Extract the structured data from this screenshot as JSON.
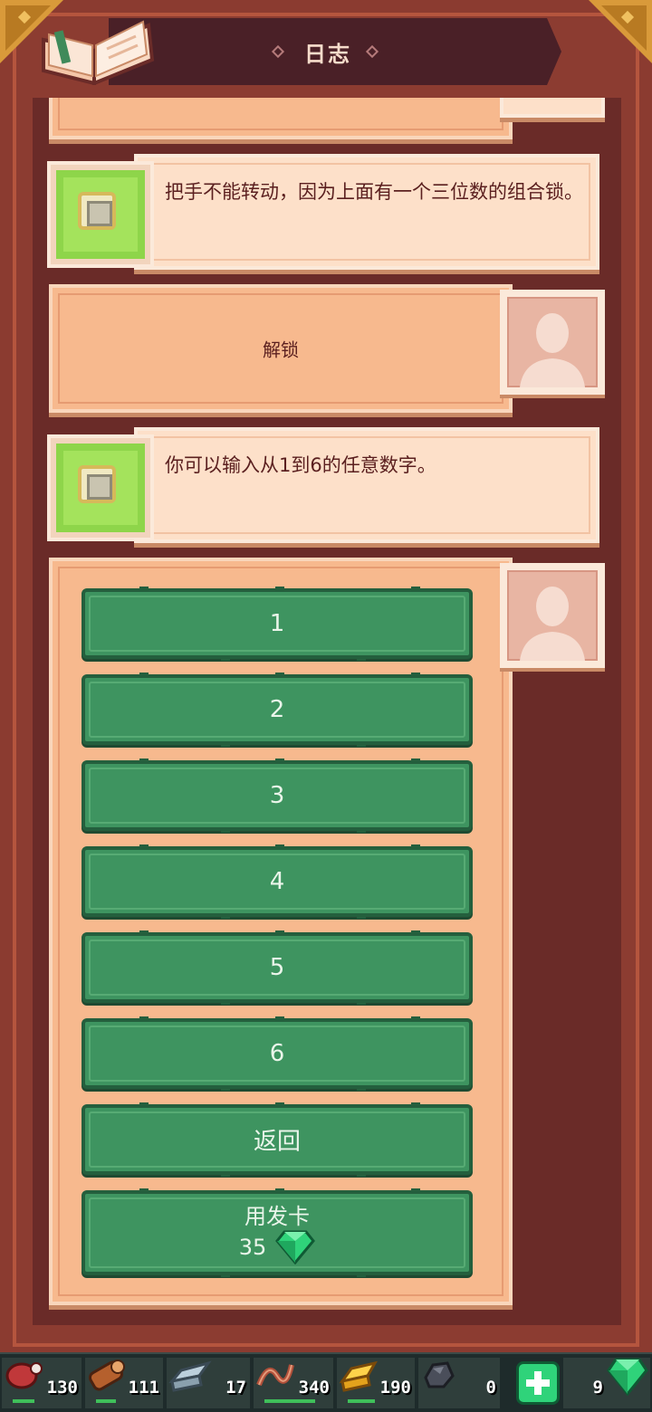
{
  "header": {
    "title": "日志"
  },
  "log": {
    "message_1": "把手不能转动，因为上面有一个三位数的组合锁。",
    "choice_1": "解锁",
    "message_2": "你可以输入从1到6的任意数字。"
  },
  "options": [
    {
      "label": "1"
    },
    {
      "label": "2"
    },
    {
      "label": "3"
    },
    {
      "label": "4"
    },
    {
      "label": "5"
    },
    {
      "label": "6"
    },
    {
      "label": "返回"
    }
  ],
  "card_option": {
    "label": "用发卡",
    "cost": "35"
  },
  "resources": {
    "meat": "130",
    "wood": "111",
    "iron": "17",
    "rope": "340",
    "gold": "190",
    "coal": "0",
    "gems": "9"
  },
  "colors": {
    "button_green": "#3e9460",
    "panel_peach": "#f7b98e",
    "frame_brown": "#8b3b30"
  }
}
